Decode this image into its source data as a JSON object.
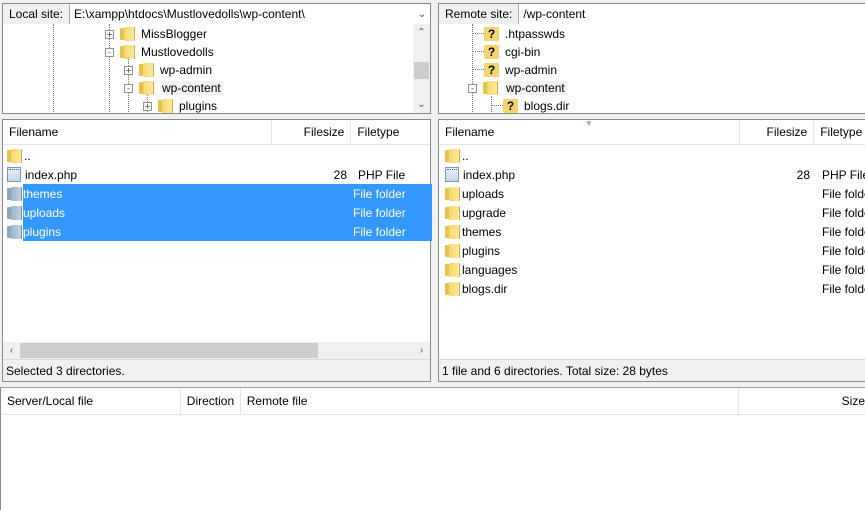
{
  "local": {
    "label": "Local site:",
    "path": "E:\\xampp\\htdocs\\Mustlovedolls\\wp-content\\",
    "tree": [
      {
        "name": "MissBlogger",
        "expander": "+"
      },
      {
        "name": "Mustlovedolls",
        "expander": "-"
      },
      {
        "name": "wp-admin",
        "expander": "+"
      },
      {
        "name": "wp-content",
        "expander": "-"
      },
      {
        "name": "plugins",
        "expander": "+"
      }
    ],
    "columns": [
      "Filename",
      "Filesize",
      "Filetype"
    ],
    "files": [
      {
        "name": "..",
        "size": "",
        "type": "",
        "icon": "folder-icon",
        "selected": false
      },
      {
        "name": "index.php",
        "size": "28",
        "type": "PHP File",
        "icon": "file-icon",
        "selected": false
      },
      {
        "name": "themes",
        "size": "",
        "type": "File folder",
        "icon": "folder-icon",
        "selected": true
      },
      {
        "name": "uploads",
        "size": "",
        "type": "File folder",
        "icon": "folder-icon",
        "selected": true
      },
      {
        "name": "plugins",
        "size": "",
        "type": "File folder",
        "icon": "folder-icon",
        "selected": true
      }
    ],
    "status": "Selected 3 directories."
  },
  "remote": {
    "label": "Remote site:",
    "path": "/wp-content",
    "tree": [
      {
        "name": ".htpasswds",
        "icon": "unknown-folder-icon"
      },
      {
        "name": "cgi-bin",
        "icon": "unknown-folder-icon"
      },
      {
        "name": "wp-admin",
        "icon": "unknown-folder-icon"
      },
      {
        "name": "wp-content",
        "icon": "folder-icon",
        "expander": "-"
      },
      {
        "name": "blogs.dir",
        "icon": "unknown-folder-icon"
      }
    ],
    "columns": [
      "Filename",
      "Filesize",
      "Filetype"
    ],
    "files": [
      {
        "name": "..",
        "size": "",
        "type": ""
      },
      {
        "name": "index.php",
        "size": "28",
        "type": "PHP File"
      },
      {
        "name": "uploads",
        "size": "",
        "type": "File folder"
      },
      {
        "name": "upgrade",
        "size": "",
        "type": "File folder"
      },
      {
        "name": "themes",
        "size": "",
        "type": "File folder"
      },
      {
        "name": "plugins",
        "size": "",
        "type": "File folder"
      },
      {
        "name": "languages",
        "size": "",
        "type": "File folder"
      },
      {
        "name": "blogs.dir",
        "size": "",
        "type": "File folder"
      }
    ],
    "status": "1 file and 6 directories. Total size: 28 bytes"
  },
  "queue": {
    "columns": [
      "Server/Local file",
      "Direction",
      "Remote file",
      "Size"
    ]
  },
  "colors": {
    "selection": "#3399ff",
    "folder": "#f6d871"
  }
}
